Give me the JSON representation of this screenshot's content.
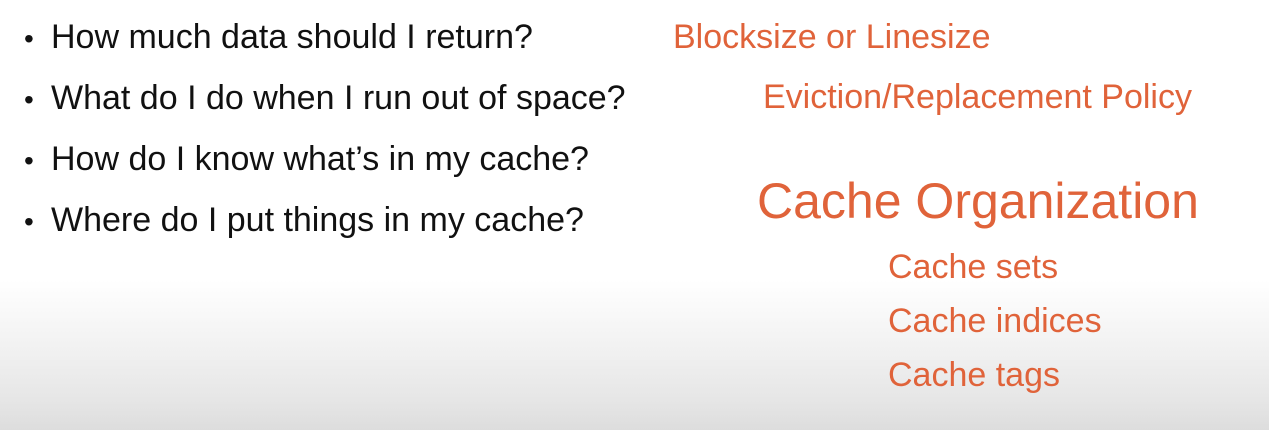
{
  "bullets": [
    {
      "dot": "•",
      "text": "How much data should I return?"
    },
    {
      "dot": "•",
      "text": "What do I do when I run out of space?"
    },
    {
      "dot": "•",
      "text": "How do I know what’s in my cache?"
    },
    {
      "dot": "•",
      "text": "Where do I put things in my cache?"
    }
  ],
  "annotations": {
    "blocksize": "Blocksize or Linesize",
    "eviction": "Eviction/Replacement Policy",
    "organization": "Cache Organization",
    "organization_items": [
      "Cache sets",
      "Cache indices",
      "Cache tags"
    ]
  },
  "colors": {
    "text": "#111111",
    "accent": "#e0633a"
  }
}
